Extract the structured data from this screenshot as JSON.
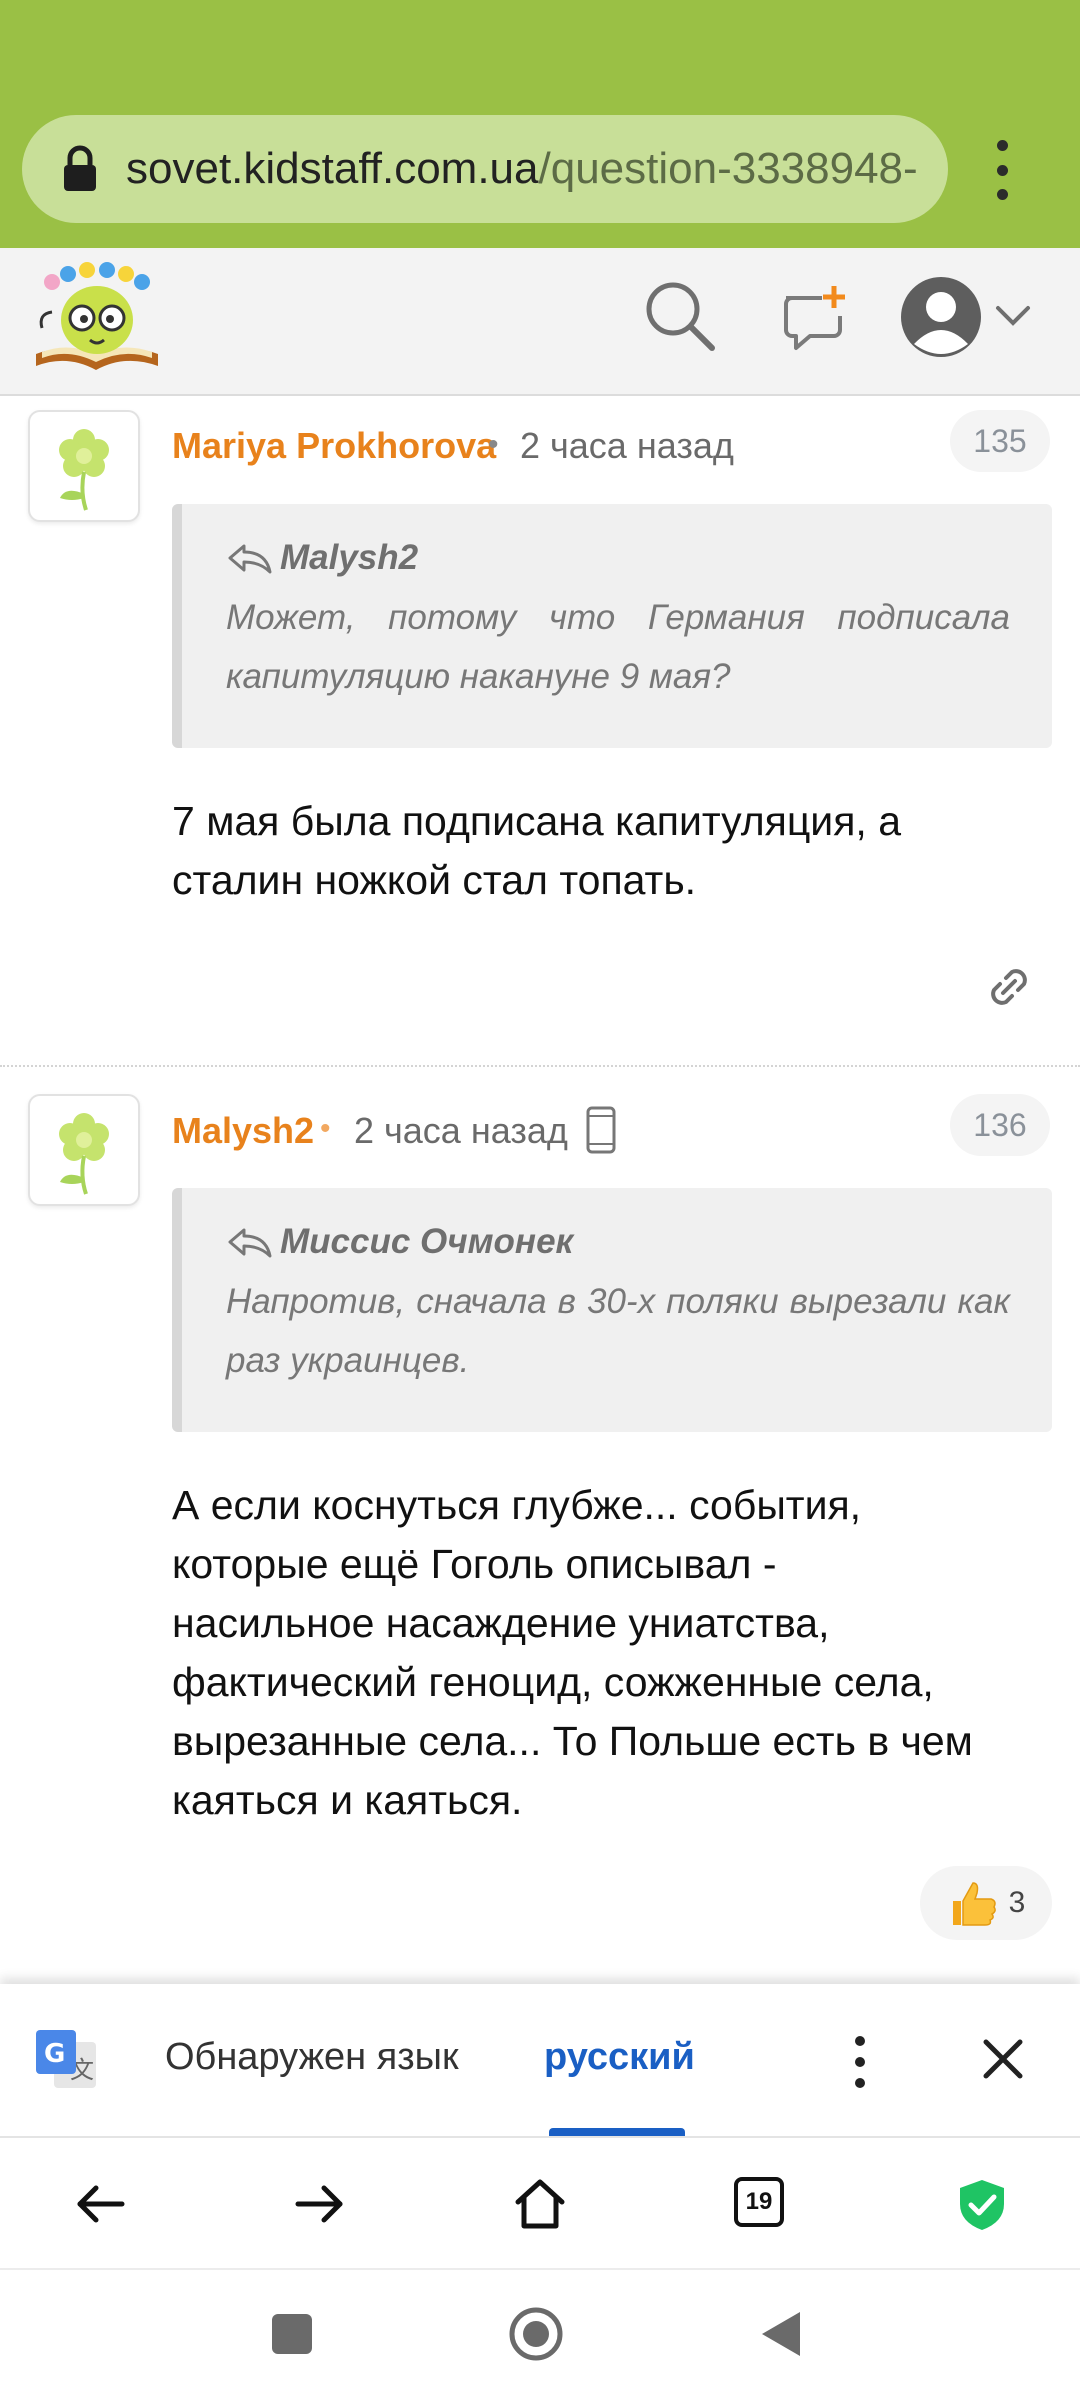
{
  "browser": {
    "url_domain": "sovet.kidstaff.com.ua",
    "url_path": "/question-3338948-"
  },
  "comments": [
    {
      "author": "Mariya Prokhorova",
      "time": "2 часа назад",
      "number": "135",
      "quote_author": "Malysh2",
      "quote_text": "Может, потому что Германия подписала капитуляцию накануне 9 мая?",
      "text_lines": [
        "7 мая была подписана капитуляция, а",
        "сталин ножкой стал топать."
      ]
    },
    {
      "author": "Malysh2",
      "time": "2 часа назад",
      "number": "136",
      "quote_author": "Миссис Очмонек",
      "quote_text": "Напротив, сначала в 30-х поляки вырезали как раз украинцев.",
      "text_lines": [
        "А если коснуться глубже... события,",
        "которые ещё Гоголь описывал -",
        "насильное насаждение униатства,",
        "фактический геноцид, сожженные села,",
        "вырезанные села... То Польше есть в чем",
        "каяться и каяться."
      ],
      "likes": "3"
    }
  ],
  "translate_bar": {
    "detected_label": "Обнаружен язык",
    "language": "русский"
  },
  "toolbar": {
    "tabs_count": "19"
  },
  "colors": {
    "browser_bar": "#9ac045",
    "author": "#e8821c",
    "translate_accent": "#1a5fc4",
    "shield": "#1fc464"
  }
}
